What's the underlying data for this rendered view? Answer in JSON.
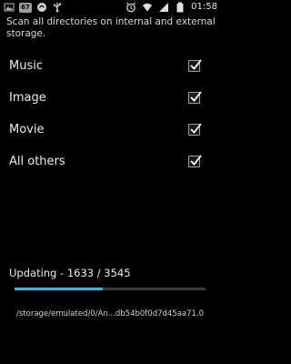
{
  "status_bar": {
    "left_icons": [
      "image-icon",
      "notification-badge",
      "sync-icon",
      "usb-icon"
    ],
    "badge_text": "67",
    "right_icons": [
      "alarm-icon",
      "wifi-icon",
      "signal-icon",
      "battery-icon"
    ],
    "time": "01:58"
  },
  "description": "Scan all directories on internal and external storage.",
  "options": [
    {
      "label": "Music",
      "checked": true
    },
    {
      "label": "Image",
      "checked": true
    },
    {
      "label": "Movie",
      "checked": true
    },
    {
      "label": "All others",
      "checked": true
    }
  ],
  "progress": {
    "label": "Updating - 1633 / 3545",
    "current": 1633,
    "total": 3545,
    "fraction": 0.4606,
    "accent_color": "#33b5e5"
  },
  "current_path": "/storage/emulated/0/An...db54b0f0d7d45aa71.0"
}
